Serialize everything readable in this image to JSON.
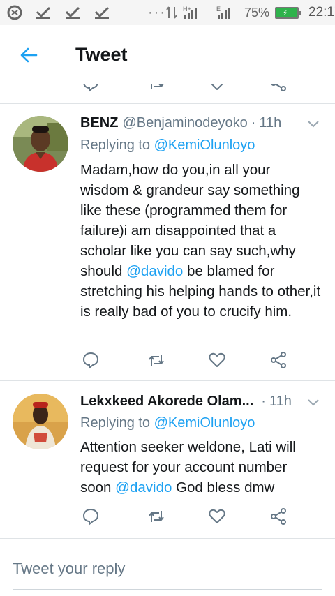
{
  "status_bar": {
    "battery": "75%",
    "time": "22:17",
    "dots": "···"
  },
  "header": {
    "title": "Tweet"
  },
  "tweets": [
    {
      "name": "BENZ",
      "handle": "@Benjaminodeyoko",
      "dot": "·",
      "time": "11h",
      "replying_prefix": "Replying to ",
      "replying_to": "@KemiOlunloyo",
      "body_parts": [
        "Madam,how do you,in all your wisdom & grandeur say something like these (programmed them for failure)i am disappointed that a scholar like you can say such,why should ",
        "@davido",
        " be blamed for stretching his helping hands to other,it is really bad of you to crucify him."
      ]
    },
    {
      "name": "Lekxkeed Akorede Olam...",
      "handle": "",
      "dot": "·",
      "time": "11h",
      "replying_prefix": "Replying to ",
      "replying_to": "@KemiOlunloyo",
      "body_parts": [
        "Attention seeker weldone, Lati will request for your account number soon ",
        "@davido",
        " God bless dmw"
      ]
    }
  ],
  "reply": {
    "placeholder": "Tweet your reply"
  },
  "colors": {
    "accent": "#1da1f2",
    "muted": "#657786",
    "text": "#14171a",
    "battery": "#2fb24c"
  },
  "icons": [
    "whatsapp-icon",
    "check-icon",
    "check-icon",
    "check-icon",
    "signal-icon",
    "battery-icon",
    "back-arrow-icon",
    "reply-icon",
    "retweet-icon",
    "like-icon",
    "share-icon",
    "chevron-down-icon"
  ]
}
